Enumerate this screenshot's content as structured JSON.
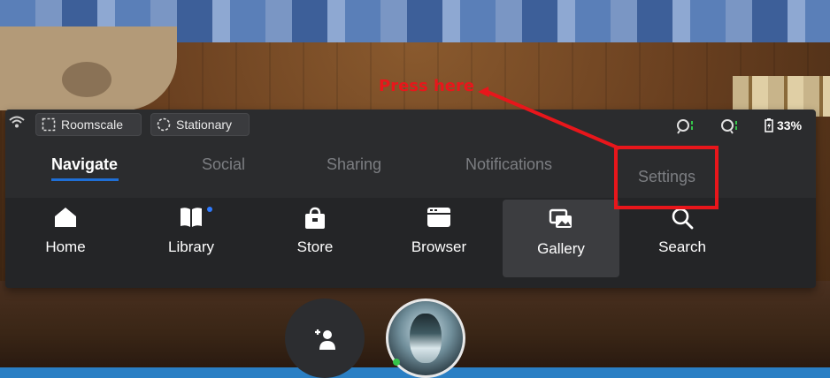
{
  "status_bar": {
    "guardian_modes": [
      {
        "label": "Roomscale",
        "icon": "roomscale-icon"
      },
      {
        "label": "Stationary",
        "icon": "stationary-icon"
      }
    ],
    "battery": "33%",
    "icons": [
      "wifi-icon",
      "left-controller-icon",
      "right-controller-icon",
      "battery-icon"
    ]
  },
  "tabs": [
    {
      "label": "Navigate",
      "active": true
    },
    {
      "label": "Social"
    },
    {
      "label": "Sharing"
    },
    {
      "label": "Notifications"
    },
    {
      "label": "Settings"
    }
  ],
  "nav": [
    {
      "label": "Home",
      "icon": "home-icon"
    },
    {
      "label": "Library",
      "icon": "library-icon"
    },
    {
      "label": "Store",
      "icon": "store-icon"
    },
    {
      "label": "Browser",
      "icon": "browser-icon"
    },
    {
      "label": "Gallery",
      "icon": "gallery-icon",
      "selected": true
    },
    {
      "label": "Search",
      "icon": "search-icon"
    }
  ],
  "annotation": {
    "text": "Press here",
    "color": "#e8161b"
  },
  "bottom_buttons": [
    {
      "icon": "add-friend-icon"
    },
    {
      "icon": "avatar"
    }
  ],
  "colors": {
    "panel": "#2b2c2e",
    "active_tab_underline": "#1f6fd6",
    "notification_dot": "#2f7bff"
  }
}
